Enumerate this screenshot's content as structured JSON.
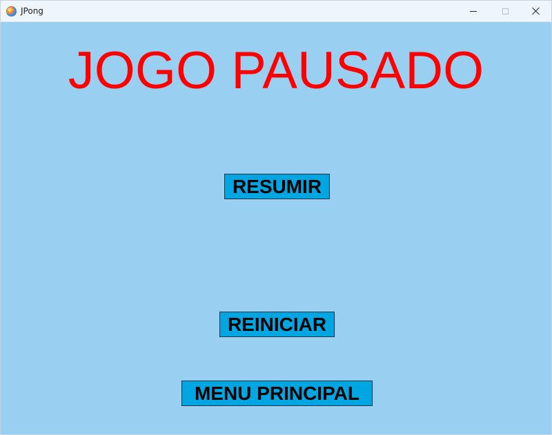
{
  "window": {
    "title": "JPong",
    "controls": {
      "minimize": "minimize",
      "maximize": "maximize",
      "close": "close"
    }
  },
  "screen": {
    "heading": "JOGO PAUSADO",
    "buttons": [
      {
        "label": "RESUMIR"
      },
      {
        "label": "REINICIAR"
      },
      {
        "label": "MENU PRINCIPAL"
      }
    ]
  },
  "colors": {
    "background": "#99cff1",
    "heading": "#ff0000",
    "button_fill": "#00a6e2",
    "button_text": "#000000"
  },
  "icons": {
    "app": "app-icon",
    "minimize": "minimize-icon",
    "maximize": "maximize-icon",
    "close": "close-icon"
  }
}
